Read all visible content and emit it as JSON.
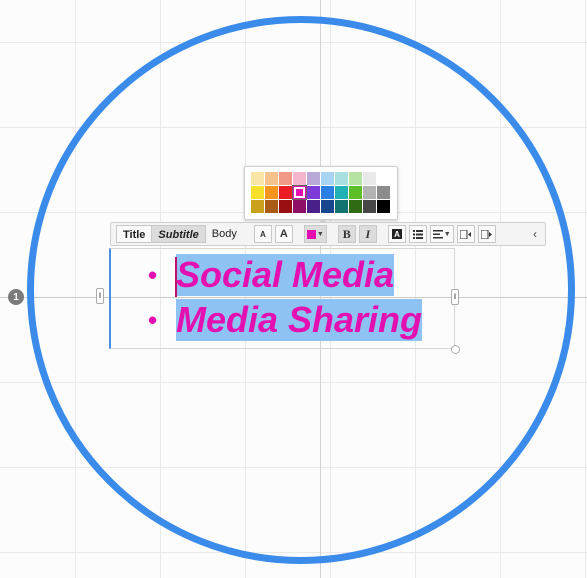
{
  "canvas": {
    "row_marker": "1",
    "circle_color": "#3b8bea"
  },
  "palette": {
    "colors": [
      "#f9e6a6",
      "#f6c28c",
      "#f29886",
      "#f4b6cf",
      "#b9a9d6",
      "#a6d4f2",
      "#a8e0e0",
      "#b5e3a1",
      "#e9e9e9",
      "#ffffff",
      "#f7e02a",
      "#f5941f",
      "#ec1c24",
      "#e40fb0",
      "#7e3bd9",
      "#2a7fe0",
      "#21b1b4",
      "#5cbf28",
      "#b3b3b3",
      "#8c8c8c",
      "#c9a11c",
      "#a95c17",
      "#9a0f12",
      "#8d1066",
      "#4b1f8a",
      "#17468f",
      "#117270",
      "#2f6b12",
      "#474747",
      "#000000"
    ],
    "selected_color": "#e40fb0"
  },
  "toolbar": {
    "style_title": "Title",
    "style_subtitle": "Subtitle",
    "style_body": "Body",
    "decrease_font": "A",
    "increase_font": "A",
    "text_color": "#e40fb0",
    "bold": "B",
    "italic": "I",
    "collapse": "‹"
  },
  "textbox": {
    "items": [
      {
        "bullet": "•",
        "text": "Social Media"
      },
      {
        "bullet": "•",
        "text": "Media Sharing"
      }
    ]
  }
}
